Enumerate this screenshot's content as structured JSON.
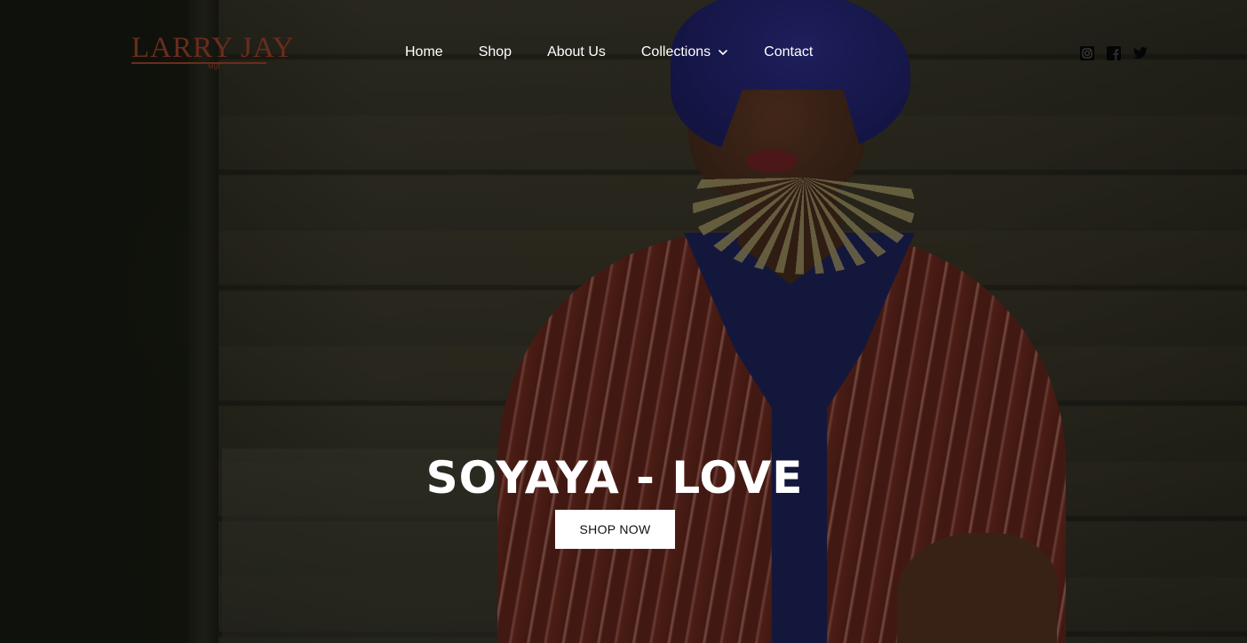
{
  "brand": {
    "logo_text": "LARRY JAY",
    "logo_sub": "Mgt",
    "logo_color": "#6b2c1d"
  },
  "nav": {
    "items": [
      {
        "label": "Home"
      },
      {
        "label": "Shop"
      },
      {
        "label": "About Us"
      },
      {
        "label": "Collections",
        "has_dropdown": true,
        "icon": "chevron-down-icon"
      },
      {
        "label": "Contact"
      }
    ]
  },
  "socials": [
    {
      "icon": "instagram-icon"
    },
    {
      "icon": "facebook-icon"
    },
    {
      "icon": "twitter-icon"
    }
  ],
  "hero": {
    "title": "SOYAYA - LOVE",
    "cta_label": "SHOP NOW"
  }
}
